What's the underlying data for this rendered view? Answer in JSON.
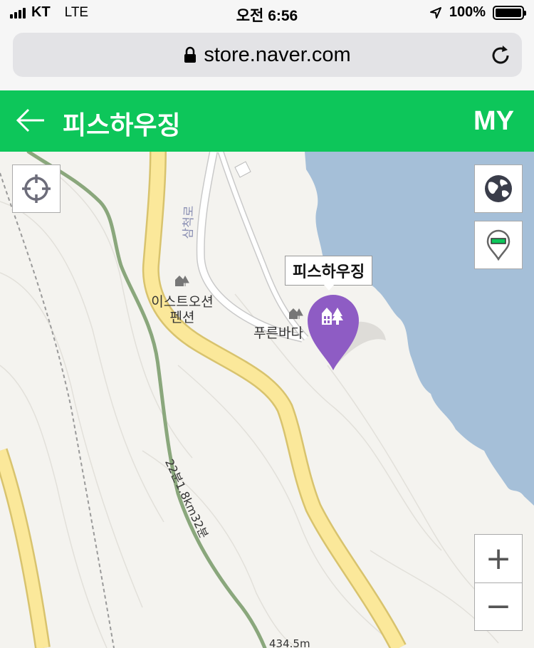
{
  "status_bar": {
    "carrier": "KT",
    "network": "LTE",
    "time": "오전 6:56",
    "battery": "100%"
  },
  "address_bar": {
    "url": "store.naver.com"
  },
  "header": {
    "title": "피스하우징",
    "my_label": "MY",
    "color": "#0dc65a"
  },
  "map": {
    "marker_label": "피스하우징",
    "places": [
      {
        "name": "이스트오션\n펜션"
      },
      {
        "name": "푸른바다"
      }
    ],
    "road_name": "삼척로",
    "route_label": "22분1.8km32분",
    "elevation_label": "434.5m",
    "colors": {
      "water": "#a5bfd8",
      "land": "#f4f3ef",
      "main_road": "#fbe89a",
      "trail": "#8aa77c",
      "marker": "#8e5cc4"
    }
  },
  "controls": {
    "zoom_in": "+",
    "zoom_out": "−"
  },
  "icons": [
    "signal-icon",
    "location-arrow-icon",
    "battery-icon",
    "lock-icon",
    "reload-icon",
    "back-arrow-icon",
    "crosshair-icon",
    "globe-icon",
    "map-pin-toggle-icon",
    "marker-lodging-icon"
  ]
}
